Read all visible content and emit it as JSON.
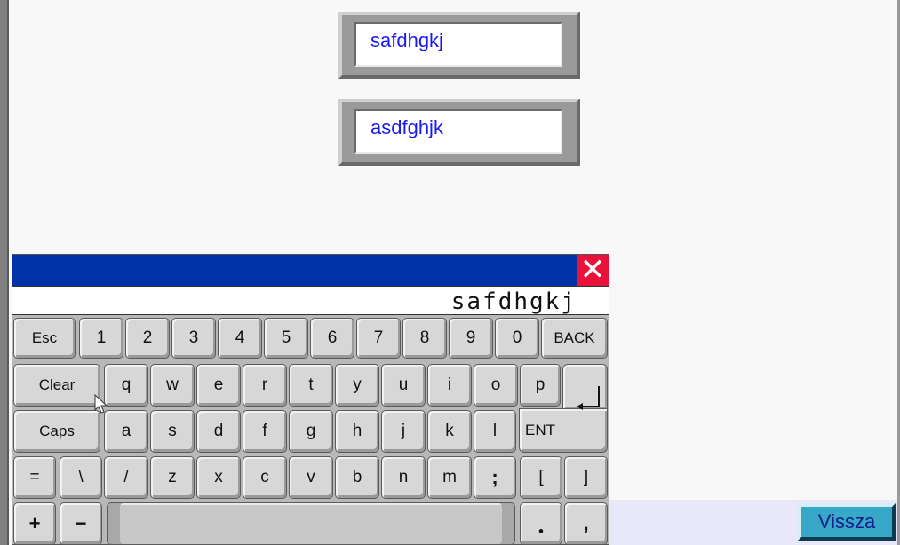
{
  "fields": [
    {
      "value": "safdhgkj"
    },
    {
      "value": "asdfghjk"
    }
  ],
  "keyboard": {
    "close_glyph": "✕",
    "display_value": "safdhgkj",
    "keys": {
      "esc": "Esc",
      "k1": "1",
      "k2": "2",
      "k3": "3",
      "k4": "4",
      "k5": "5",
      "k6": "6",
      "k7": "7",
      "k8": "8",
      "k9": "9",
      "k0": "0",
      "back": "BACK",
      "clear": "Clear",
      "q": "q",
      "w": "w",
      "e": "e",
      "r": "r",
      "t": "t",
      "y": "y",
      "u": "u",
      "i": "i",
      "o": "o",
      "p": "p",
      "caps": "Caps",
      "a": "a",
      "s": "s",
      "d": "d",
      "f": "f",
      "g": "g",
      "h": "h",
      "j": "j",
      "k": "k",
      "l": "l",
      "ent": "ENT",
      "equals": "=",
      "backslash": "\\",
      "slash": "/",
      "z": "z",
      "x": "x",
      "c": "c",
      "v": "v",
      "b": "b",
      "n": "n",
      "m": "m",
      "semicolon": ";",
      "lbracket": "[",
      "rbracket": "]",
      "plus": "+",
      "minus": "−",
      "dot": "•",
      "comma": ","
    }
  },
  "footer": {
    "back_label": "Vissza"
  },
  "colors": {
    "titlebar": "#0033aa",
    "close": "#e8133a",
    "field_text": "#1a1af0",
    "vissza_bg": "#37a8c8"
  },
  "icons": {
    "close": "close-icon",
    "enter": "enter-arrow-icon",
    "cursor": "mouse-pointer-icon"
  }
}
